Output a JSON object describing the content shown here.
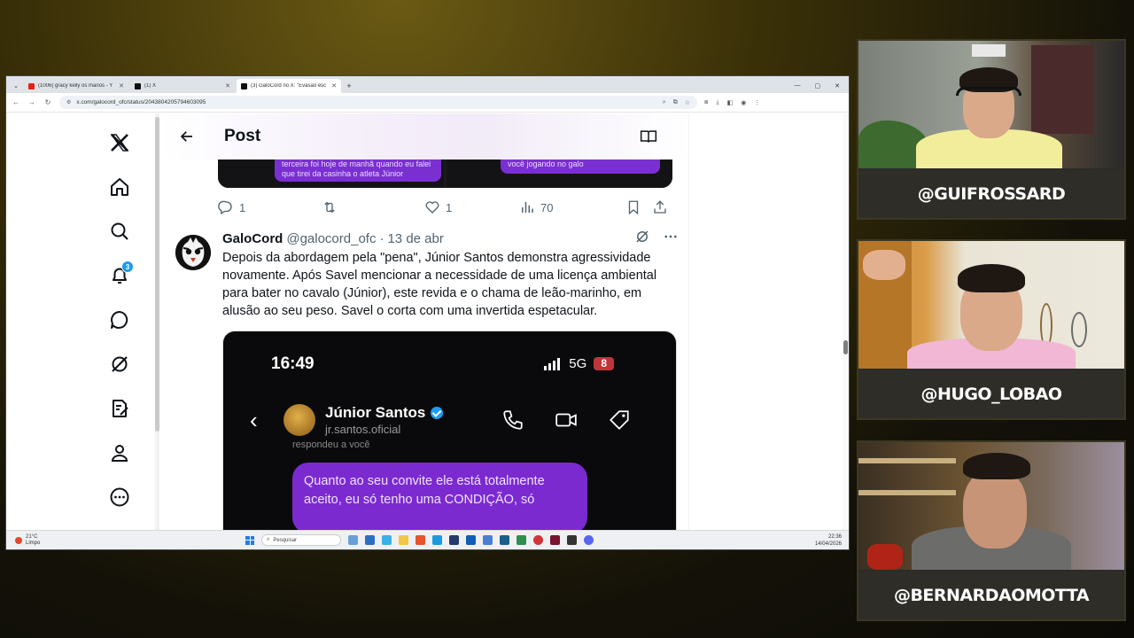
{
  "browser": {
    "tabs": [
      {
        "title": "(1006) gracy kelly os manos - Y",
        "favicon": "youtube",
        "active": false
      },
      {
        "title": "(1) X",
        "favicon": "x",
        "active": false
      },
      {
        "title": "(3) GaloCord no X: \"Evasão esc",
        "favicon": "x",
        "active": true
      }
    ],
    "url": "x.com/galocord_ofc/status/2043804205794603095"
  },
  "x": {
    "header_title": "Post",
    "notification_count": "3",
    "nav_icons": [
      "x-logo-icon",
      "home-icon",
      "search-icon",
      "bell-icon",
      "chat-icon",
      "grok-icon",
      "compose-icon",
      "profile-icon",
      "more-icon"
    ],
    "quoted_bubbles": {
      "left": "quando ganhou a copa do Brasil e a terceira foi hoje de manhã quando eu falei que tirei da casinha o atleta Júnior",
      "right": "muito ruim pros meus olhos que viram você jogando no galo"
    },
    "prev_actions": {
      "replies": "1",
      "likes": "1",
      "views": "70"
    },
    "tweet": {
      "name": "GaloCord",
      "handle": "@galocord_ofc",
      "date": "13 de abr",
      "text": "Depois da abordagem pela \"pena\", Júnior Santos demonstra agressividade novamente. Após Savel mencionar a necessidade de uma licença ambiental para bater no cavalo (Júnior), este revida e o chama de leão-marinho, em alusão ao seu peso. Savel o corta com uma invertida espetacular.",
      "media": {
        "time": "16:49",
        "network": "5G",
        "battery": "8",
        "contact_name": "Júnior Santos",
        "contact_handle": "jr.santos.oficial",
        "responded": "respondeu a você",
        "message": "Quanto ao seu convite ele está totalmente aceito, eu só tenho uma CONDIÇÃO, só"
      }
    }
  },
  "taskbar": {
    "temperature": "21°C",
    "weather": "Limpo",
    "search_placeholder": "Pesquisar",
    "time": "22:36",
    "date": "14/04/2026"
  },
  "webcams": [
    {
      "handle": "@GUIFROSSARD"
    },
    {
      "handle": "@HUGO_LOBAO"
    },
    {
      "handle": "@BERNARDAOMOTTA"
    }
  ],
  "colors": {
    "x_blue": "#1d9bf0",
    "chat_purple": "#7b2ad0",
    "label_bg": "#2e2d28"
  }
}
